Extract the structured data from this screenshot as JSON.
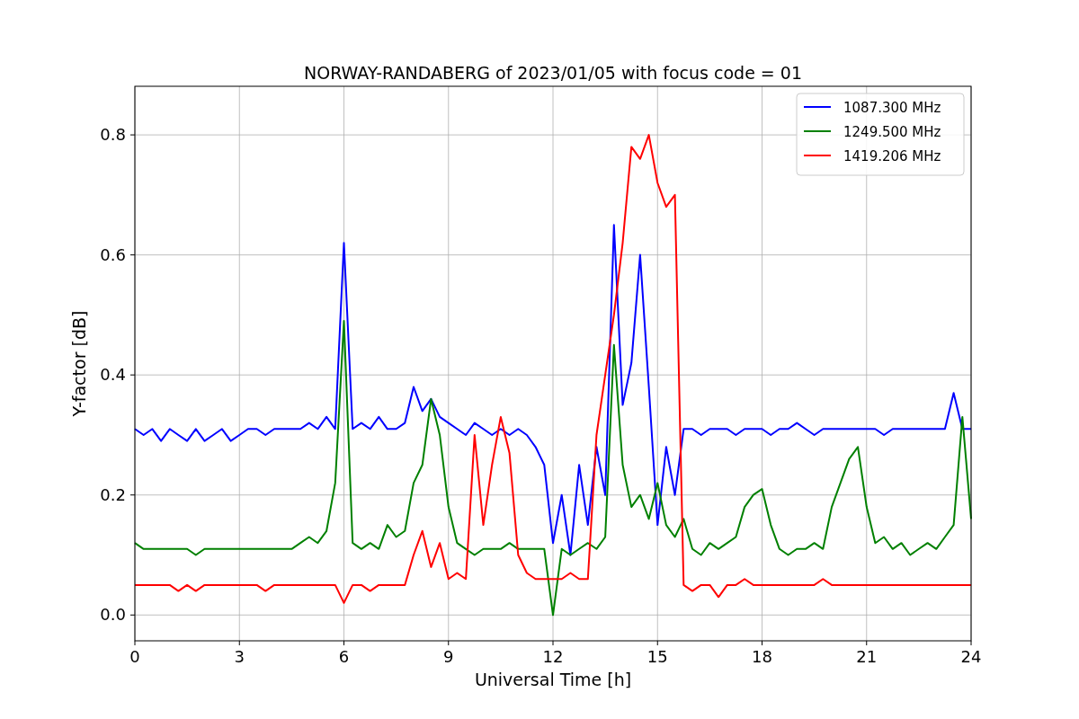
{
  "chart_data": {
    "type": "line",
    "title": "NORWAY-RANDABERG of 2023/01/05 with focus code = 01",
    "xlabel": "Universal Time [h]",
    "ylabel": "Y-factor [dB]",
    "x": [
      0,
      0.25,
      0.5,
      0.75,
      1,
      1.25,
      1.5,
      1.75,
      2,
      2.25,
      2.5,
      2.75,
      3,
      3.25,
      3.5,
      3.75,
      4,
      4.25,
      4.5,
      4.75,
      5,
      5.25,
      5.5,
      5.75,
      6,
      6.25,
      6.5,
      6.75,
      7,
      7.25,
      7.5,
      7.75,
      8,
      8.25,
      8.5,
      8.75,
      9,
      9.25,
      9.5,
      9.75,
      10,
      10.25,
      10.5,
      10.75,
      11,
      11.25,
      11.5,
      11.75,
      12,
      12.25,
      12.5,
      12.75,
      13,
      13.25,
      13.5,
      13.75,
      14,
      14.25,
      14.5,
      14.75,
      15,
      15.25,
      15.5,
      15.75,
      16,
      16.25,
      16.5,
      16.75,
      17,
      17.25,
      17.5,
      17.75,
      18,
      18.25,
      18.5,
      18.75,
      19,
      19.25,
      19.5,
      19.75,
      20,
      20.25,
      20.5,
      20.75,
      21,
      21.25,
      21.5,
      21.75,
      22,
      22.25,
      22.5,
      22.75,
      23,
      23.25,
      23.5,
      23.75,
      24
    ],
    "series": [
      {
        "name": "1087.300 MHz",
        "color": "#0000ff",
        "values": [
          0.31,
          0.3,
          0.31,
          0.29,
          0.31,
          0.3,
          0.29,
          0.31,
          0.29,
          0.3,
          0.31,
          0.29,
          0.3,
          0.31,
          0.31,
          0.3,
          0.31,
          0.31,
          0.31,
          0.31,
          0.32,
          0.31,
          0.33,
          0.31,
          0.62,
          0.31,
          0.32,
          0.31,
          0.33,
          0.31,
          0.31,
          0.32,
          0.38,
          0.34,
          0.36,
          0.33,
          0.32,
          0.31,
          0.3,
          0.32,
          0.31,
          0.3,
          0.31,
          0.3,
          0.31,
          0.3,
          0.28,
          0.25,
          0.12,
          0.2,
          0.1,
          0.25,
          0.15,
          0.28,
          0.2,
          0.65,
          0.35,
          0.42,
          0.6,
          0.38,
          0.15,
          0.28,
          0.2,
          0.31,
          0.31,
          0.3,
          0.31,
          0.31,
          0.31,
          0.3,
          0.31,
          0.31,
          0.31,
          0.3,
          0.31,
          0.31,
          0.32,
          0.31,
          0.3,
          0.31,
          0.31,
          0.31,
          0.31,
          0.31,
          0.31,
          0.31,
          0.3,
          0.31,
          0.31,
          0.31,
          0.31,
          0.31,
          0.31,
          0.31,
          0.37,
          0.31,
          0.31
        ]
      },
      {
        "name": "1249.500 MHz",
        "color": "#008000",
        "values": [
          0.12,
          0.11,
          0.11,
          0.11,
          0.11,
          0.11,
          0.11,
          0.1,
          0.11,
          0.11,
          0.11,
          0.11,
          0.11,
          0.11,
          0.11,
          0.11,
          0.11,
          0.11,
          0.11,
          0.12,
          0.13,
          0.12,
          0.14,
          0.22,
          0.49,
          0.12,
          0.11,
          0.12,
          0.11,
          0.15,
          0.13,
          0.14,
          0.22,
          0.25,
          0.36,
          0.3,
          0.18,
          0.12,
          0.11,
          0.1,
          0.11,
          0.11,
          0.11,
          0.12,
          0.11,
          0.11,
          0.11,
          0.11,
          0.0,
          0.11,
          0.1,
          0.11,
          0.12,
          0.11,
          0.13,
          0.45,
          0.25,
          0.18,
          0.2,
          0.16,
          0.22,
          0.15,
          0.13,
          0.16,
          0.11,
          0.1,
          0.12,
          0.11,
          0.12,
          0.13,
          0.18,
          0.2,
          0.21,
          0.15,
          0.11,
          0.1,
          0.11,
          0.11,
          0.12,
          0.11,
          0.18,
          0.22,
          0.26,
          0.28,
          0.18,
          0.12,
          0.13,
          0.11,
          0.12,
          0.1,
          0.11,
          0.12,
          0.11,
          0.13,
          0.15,
          0.33,
          0.16
        ]
      },
      {
        "name": "1419.206 MHz",
        "color": "#ff0000",
        "values": [
          0.05,
          0.05,
          0.05,
          0.05,
          0.05,
          0.04,
          0.05,
          0.04,
          0.05,
          0.05,
          0.05,
          0.05,
          0.05,
          0.05,
          0.05,
          0.04,
          0.05,
          0.05,
          0.05,
          0.05,
          0.05,
          0.05,
          0.05,
          0.05,
          0.02,
          0.05,
          0.05,
          0.04,
          0.05,
          0.05,
          0.05,
          0.05,
          0.1,
          0.14,
          0.08,
          0.12,
          0.06,
          0.07,
          0.06,
          0.3,
          0.15,
          0.25,
          0.33,
          0.27,
          0.1,
          0.07,
          0.06,
          0.06,
          0.06,
          0.06,
          0.07,
          0.06,
          0.06,
          0.3,
          0.4,
          0.5,
          0.62,
          0.78,
          0.76,
          0.8,
          0.72,
          0.68,
          0.7,
          0.05,
          0.04,
          0.05,
          0.05,
          0.03,
          0.05,
          0.05,
          0.06,
          0.05,
          0.05,
          0.05,
          0.05,
          0.05,
          0.05,
          0.05,
          0.05,
          0.06,
          0.05,
          0.05,
          0.05,
          0.05,
          0.05,
          0.05,
          0.05,
          0.05,
          0.05,
          0.05,
          0.05,
          0.05,
          0.05,
          0.05,
          0.05,
          0.05,
          0.05
        ]
      }
    ],
    "grid": true,
    "legend": true,
    "xlim": [
      0,
      24
    ],
    "ylim": [
      -0.043,
      0.881
    ],
    "xticks": [
      0,
      3,
      6,
      9,
      12,
      15,
      18,
      21,
      24
    ],
    "yticks": [
      {
        "value": 0,
        "label": "0.0"
      },
      {
        "value": 0.2,
        "label": "0.2"
      },
      {
        "value": 0.4,
        "label": "0.4"
      },
      {
        "value": 0.6,
        "label": "0.6"
      },
      {
        "value": 0.8,
        "label": "0.8"
      }
    ]
  }
}
